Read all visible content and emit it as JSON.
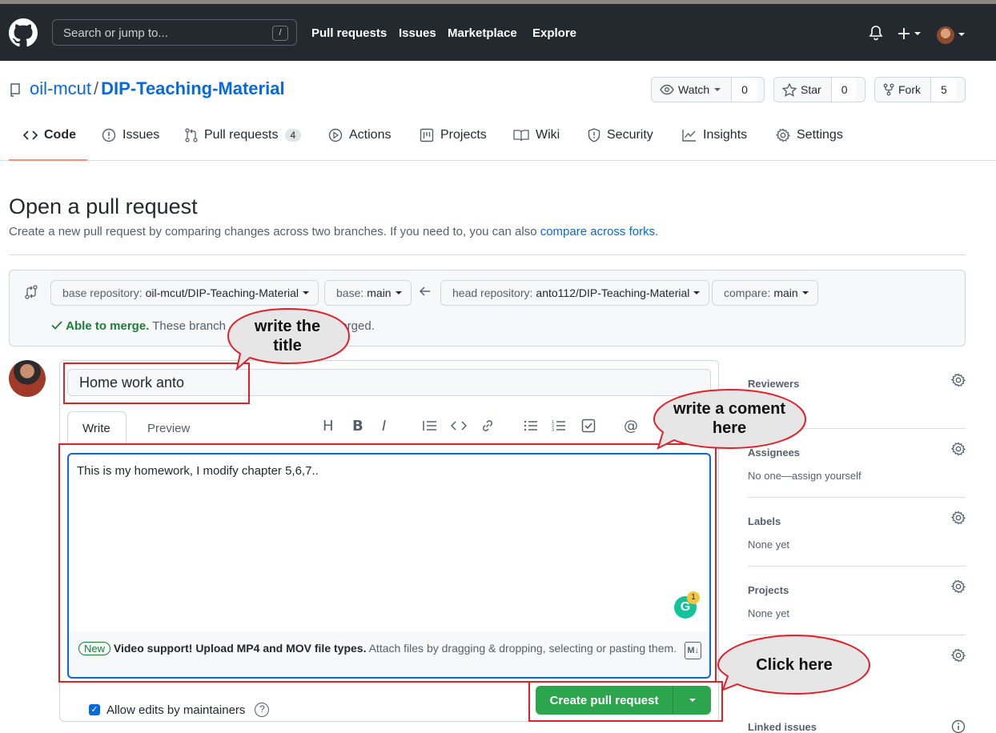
{
  "header": {
    "search_placeholder": "Search or jump to...",
    "search_key": "/",
    "nav": [
      "Pull requests",
      "Issues",
      "Marketplace",
      "Explore"
    ],
    "plus": "+"
  },
  "repo": {
    "owner": "oil-mcut",
    "separator": "/",
    "name": "DIP-Teaching-Material",
    "watch_label": "Watch",
    "watch_count": "0",
    "star_label": "Star",
    "star_count": "0",
    "fork_label": "Fork",
    "fork_count": "5"
  },
  "tabs": [
    {
      "label": "Code",
      "icon": "code-icon"
    },
    {
      "label": "Issues",
      "icon": "issue-icon"
    },
    {
      "label": "Pull requests",
      "icon": "pr-icon",
      "count": "4"
    },
    {
      "label": "Actions",
      "icon": "play-icon"
    },
    {
      "label": "Projects",
      "icon": "project-icon"
    },
    {
      "label": "Wiki",
      "icon": "book-icon"
    },
    {
      "label": "Security",
      "icon": "shield-icon"
    },
    {
      "label": "Insights",
      "icon": "graph-icon"
    },
    {
      "label": "Settings",
      "icon": "gear-icon"
    }
  ],
  "page": {
    "title": "Open a pull request",
    "subtitle": "Create a new pull request by comparing changes across two branches. If you need to, you can also ",
    "subtitle_link": "compare across forks",
    "subtitle_end": "."
  },
  "compare": {
    "base_repo_label": "base repository:",
    "base_repo_value": "oil-mcut/DIP-Teaching-Material",
    "base_label": "base:",
    "base_value": "main",
    "head_repo_label": "head repository:",
    "head_repo_value": "anto112/DIP-Teaching-Material",
    "compare_label": "compare:",
    "compare_value": "main",
    "merge_status": "Able to merge.",
    "merge_text_before": "These branch",
    "merge_text_after": "ally merged."
  },
  "form": {
    "title_value": "Home work anto",
    "tab_write": "Write",
    "tab_preview": "Preview",
    "body_text": "This is my homework, I modify chapter 5,6,7..",
    "new_badge": "New",
    "drop_bold": "Video support! Upload MP4 and MOV file types.",
    "drop_text": " Attach files by dragging & dropping, selecting or pasting them.",
    "md_label": "M↓",
    "grammarly_letter": "G",
    "grammarly_count": "1",
    "allow_edits": "Allow edits by maintainers",
    "create_button": "Create pull request"
  },
  "sidebar": [
    {
      "heading": "Reviewers",
      "value": ""
    },
    {
      "heading": "Assignees",
      "value": "No one—assign yourself"
    },
    {
      "heading": "Labels",
      "value": "None yet"
    },
    {
      "heading": "Projects",
      "value": "None yet"
    },
    {
      "heading": "",
      "value": ""
    },
    {
      "heading": "Linked issues",
      "value": ""
    }
  ],
  "annotations": {
    "title_callout": "write the title",
    "comment_callout": "write a coment here",
    "click_callout": "Click here"
  },
  "colors": {
    "header_bg": "#24292f",
    "link": "#0969da",
    "green": "#2da44e",
    "annotation_red": "#e0212a",
    "bubble_fill": "#e6e6e6"
  }
}
